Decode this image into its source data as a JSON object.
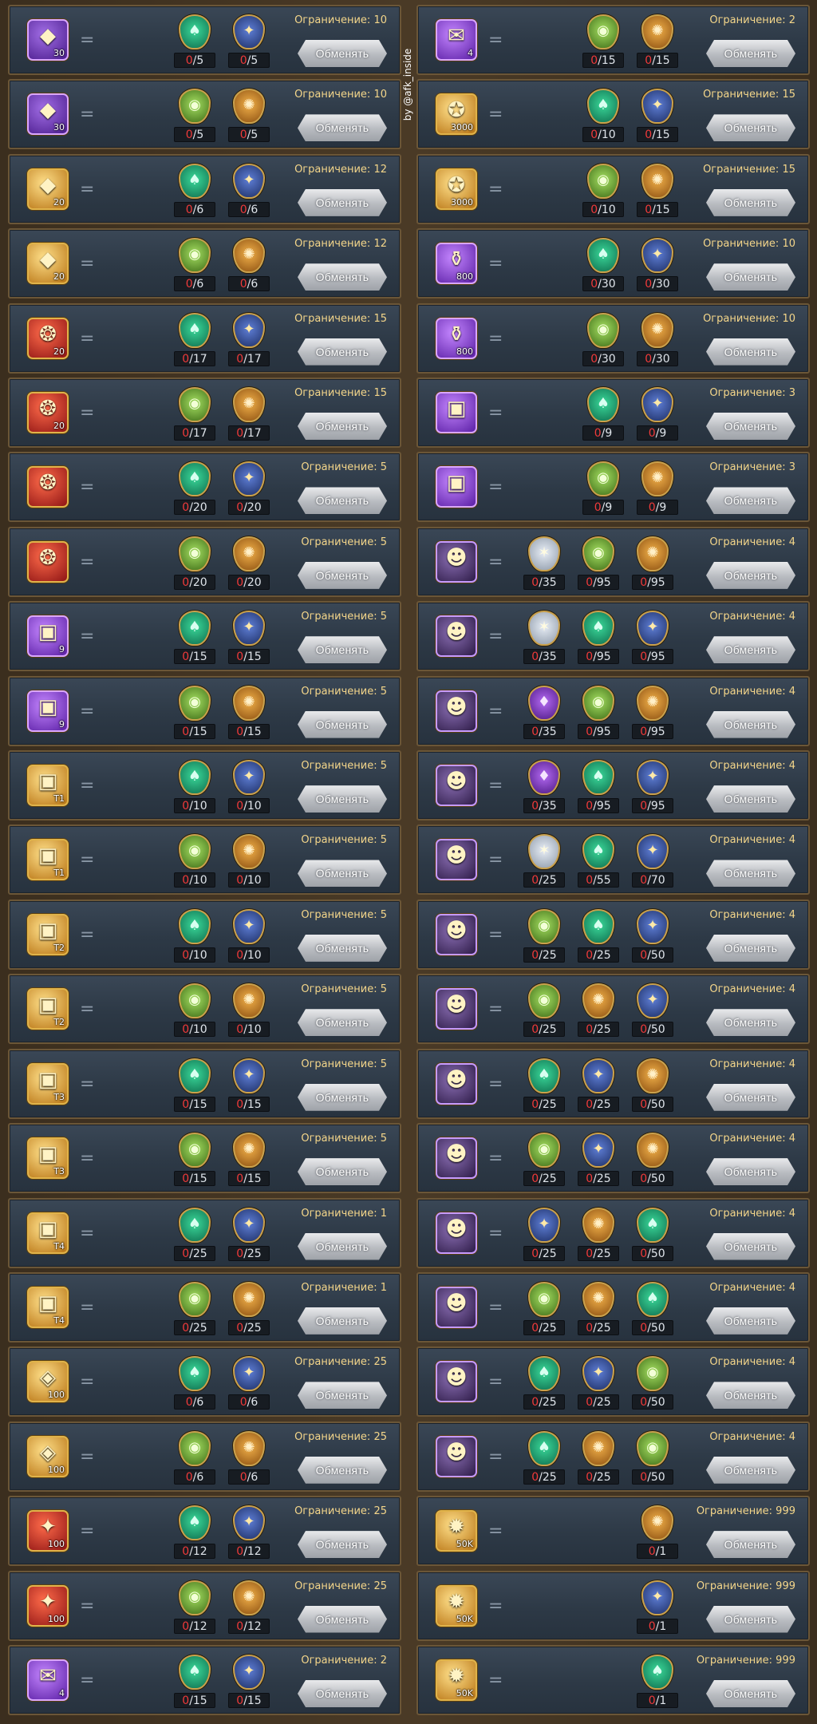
{
  "watermark": "by @afk_inside",
  "button_label": "Обменять",
  "limit_prefix": "Ограничение: ",
  "icons": {
    "green": "green-emblem-icon",
    "eye": "eye-emblem-icon",
    "star": "star-emblem-icon",
    "orb": "orb-emblem-icon",
    "silver": "silver-star-emblem-icon",
    "purple": "purple-emblem-icon",
    "coin": "gold-coin-emblem-icon"
  },
  "left_rows": [
    {
      "item": "silver-stone",
      "style": "purple",
      "glyph": "◆",
      "qty": "30",
      "limit": "10",
      "costs": [
        {
          "m": "green",
          "c": "0/5"
        },
        {
          "m": "star",
          "c": "0/5"
        }
      ]
    },
    {
      "item": "silver-stone",
      "style": "purple",
      "glyph": "◆",
      "qty": "30",
      "limit": "10",
      "costs": [
        {
          "m": "eye",
          "c": "0/5"
        },
        {
          "m": "orb",
          "c": "0/5"
        }
      ]
    },
    {
      "item": "gold-stone",
      "style": "gold",
      "glyph": "◆",
      "qty": "20",
      "limit": "12",
      "costs": [
        {
          "m": "green",
          "c": "0/6"
        },
        {
          "m": "star",
          "c": "0/6"
        }
      ]
    },
    {
      "item": "gold-stone",
      "style": "gold",
      "glyph": "◆",
      "qty": "20",
      "limit": "12",
      "costs": [
        {
          "m": "eye",
          "c": "0/6"
        },
        {
          "m": "orb",
          "c": "0/6"
        }
      ]
    },
    {
      "item": "red-chest",
      "style": "red",
      "glyph": "❂",
      "qty": "20",
      "limit": "15",
      "costs": [
        {
          "m": "green",
          "c": "0/17"
        },
        {
          "m": "star",
          "c": "0/17"
        }
      ]
    },
    {
      "item": "red-chest",
      "style": "red",
      "glyph": "❂",
      "qty": "20",
      "limit": "15",
      "costs": [
        {
          "m": "eye",
          "c": "0/17"
        },
        {
          "m": "orb",
          "c": "0/17"
        }
      ]
    },
    {
      "item": "red-shell",
      "style": "red",
      "glyph": "❂",
      "qty": "",
      "limit": "5",
      "costs": [
        {
          "m": "green",
          "c": "0/20"
        },
        {
          "m": "star",
          "c": "0/20"
        }
      ]
    },
    {
      "item": "red-shell",
      "style": "red",
      "glyph": "❂",
      "qty": "",
      "limit": "5",
      "costs": [
        {
          "m": "eye",
          "c": "0/20"
        },
        {
          "m": "orb",
          "c": "0/20"
        }
      ]
    },
    {
      "item": "purple-chest",
      "style": "violet",
      "glyph": "▣",
      "qty": "9",
      "limit": "5",
      "costs": [
        {
          "m": "green",
          "c": "0/15"
        },
        {
          "m": "star",
          "c": "0/15"
        }
      ]
    },
    {
      "item": "purple-chest",
      "style": "violet",
      "glyph": "▣",
      "qty": "9",
      "limit": "5",
      "costs": [
        {
          "m": "eye",
          "c": "0/15"
        },
        {
          "m": "orb",
          "c": "0/15"
        }
      ]
    },
    {
      "item": "t1-chest",
      "style": "gold",
      "glyph": "▣",
      "qty": "T1",
      "limit": "5",
      "costs": [
        {
          "m": "green",
          "c": "0/10"
        },
        {
          "m": "star",
          "c": "0/10"
        }
      ]
    },
    {
      "item": "t1-chest",
      "style": "gold",
      "glyph": "▣",
      "qty": "T1",
      "limit": "5",
      "costs": [
        {
          "m": "eye",
          "c": "0/10"
        },
        {
          "m": "orb",
          "c": "0/10"
        }
      ]
    },
    {
      "item": "t2-chest",
      "style": "gold",
      "glyph": "▣",
      "qty": "T2",
      "limit": "5",
      "costs": [
        {
          "m": "green",
          "c": "0/10"
        },
        {
          "m": "star",
          "c": "0/10"
        }
      ]
    },
    {
      "item": "t2-chest",
      "style": "gold",
      "glyph": "▣",
      "qty": "T2",
      "limit": "5",
      "costs": [
        {
          "m": "eye",
          "c": "0/10"
        },
        {
          "m": "orb",
          "c": "0/10"
        }
      ]
    },
    {
      "item": "t3-chest",
      "style": "gold",
      "glyph": "▣",
      "qty": "T3",
      "limit": "5",
      "costs": [
        {
          "m": "green",
          "c": "0/15"
        },
        {
          "m": "star",
          "c": "0/15"
        }
      ]
    },
    {
      "item": "t3-chest",
      "style": "gold",
      "glyph": "▣",
      "qty": "T3",
      "limit": "5",
      "costs": [
        {
          "m": "eye",
          "c": "0/15"
        },
        {
          "m": "orb",
          "c": "0/15"
        }
      ]
    },
    {
      "item": "t4-chest",
      "style": "gold",
      "glyph": "▣",
      "qty": "T4",
      "limit": "1",
      "costs": [
        {
          "m": "green",
          "c": "0/25"
        },
        {
          "m": "star",
          "c": "0/25"
        }
      ]
    },
    {
      "item": "t4-chest",
      "style": "gold",
      "glyph": "▣",
      "qty": "T4",
      "limit": "1",
      "costs": [
        {
          "m": "eye",
          "c": "0/25"
        },
        {
          "m": "orb",
          "c": "0/25"
        }
      ]
    },
    {
      "item": "blue-crystal",
      "style": "gold",
      "glyph": "◈",
      "qty": "100",
      "limit": "25",
      "costs": [
        {
          "m": "green",
          "c": "0/6"
        },
        {
          "m": "star",
          "c": "0/6"
        }
      ]
    },
    {
      "item": "blue-crystal",
      "style": "gold",
      "glyph": "◈",
      "qty": "100",
      "limit": "25",
      "costs": [
        {
          "m": "eye",
          "c": "0/6"
        },
        {
          "m": "orb",
          "c": "0/6"
        }
      ]
    },
    {
      "item": "prism-crystal",
      "style": "red",
      "glyph": "✦",
      "qty": "100",
      "limit": "25",
      "costs": [
        {
          "m": "green",
          "c": "0/12"
        },
        {
          "m": "star",
          "c": "0/12"
        }
      ]
    },
    {
      "item": "prism-crystal",
      "style": "red",
      "glyph": "✦",
      "qty": "100",
      "limit": "25",
      "costs": [
        {
          "m": "eye",
          "c": "0/12"
        },
        {
          "m": "orb",
          "c": "0/12"
        }
      ]
    },
    {
      "item": "scroll",
      "style": "violet",
      "glyph": "✉",
      "qty": "4",
      "limit": "2",
      "costs": [
        {
          "m": "green",
          "c": "0/15"
        },
        {
          "m": "star",
          "c": "0/15"
        }
      ]
    }
  ],
  "right_rows": [
    {
      "item": "scroll",
      "style": "violet",
      "glyph": "✉",
      "qty": "4",
      "limit": "2",
      "costs": [
        {
          "m": "eye",
          "c": "0/15"
        },
        {
          "m": "orb",
          "c": "0/15"
        }
      ]
    },
    {
      "item": "gold-bag",
      "style": "gold",
      "glyph": "✪",
      "qty": "3000",
      "limit": "15",
      "costs": [
        {
          "m": "green",
          "c": "0/10"
        },
        {
          "m": "star",
          "c": "0/15"
        }
      ]
    },
    {
      "item": "gold-bag",
      "style": "gold",
      "glyph": "✪",
      "qty": "3000",
      "limit": "15",
      "costs": [
        {
          "m": "eye",
          "c": "0/10"
        },
        {
          "m": "orb",
          "c": "0/15"
        }
      ]
    },
    {
      "item": "exp-potion",
      "style": "violet",
      "glyph": "⚱",
      "qty": "800",
      "limit": "10",
      "costs": [
        {
          "m": "green",
          "c": "0/30"
        },
        {
          "m": "star",
          "c": "0/30"
        }
      ]
    },
    {
      "item": "exp-potion",
      "style": "violet",
      "glyph": "⚱",
      "qty": "800",
      "limit": "10",
      "costs": [
        {
          "m": "eye",
          "c": "0/30"
        },
        {
          "m": "orb",
          "c": "0/30"
        }
      ]
    },
    {
      "item": "legend-chest",
      "style": "violet",
      "glyph": "▣",
      "qty": "",
      "limit": "3",
      "costs": [
        {
          "m": "green",
          "c": "0/9"
        },
        {
          "m": "star",
          "c": "0/9"
        }
      ]
    },
    {
      "item": "legend-chest",
      "style": "violet",
      "glyph": "▣",
      "qty": "",
      "limit": "3",
      "costs": [
        {
          "m": "eye",
          "c": "0/9"
        },
        {
          "m": "orb",
          "c": "0/9"
        }
      ]
    },
    {
      "item": "hero-1",
      "style": "hero",
      "glyph": "☻",
      "qty": "",
      "limit": "4",
      "costs": [
        {
          "m": "silver",
          "c": "0/35"
        },
        {
          "m": "eye",
          "c": "0/95"
        },
        {
          "m": "orb",
          "c": "0/95"
        }
      ]
    },
    {
      "item": "hero-2",
      "style": "hero",
      "glyph": "☻",
      "qty": "",
      "limit": "4",
      "costs": [
        {
          "m": "silver",
          "c": "0/35"
        },
        {
          "m": "green",
          "c": "0/95"
        },
        {
          "m": "star",
          "c": "0/95"
        }
      ]
    },
    {
      "item": "hero-3",
      "style": "hero",
      "glyph": "☻",
      "qty": "",
      "limit": "4",
      "costs": [
        {
          "m": "purple",
          "c": "0/35"
        },
        {
          "m": "eye",
          "c": "0/95"
        },
        {
          "m": "orb",
          "c": "0/95"
        }
      ]
    },
    {
      "item": "hero-4",
      "style": "hero",
      "glyph": "☻",
      "qty": "",
      "limit": "4",
      "costs": [
        {
          "m": "purple",
          "c": "0/35"
        },
        {
          "m": "green",
          "c": "0/95"
        },
        {
          "m": "star",
          "c": "0/95"
        }
      ]
    },
    {
      "item": "hero-5",
      "style": "hero",
      "glyph": "☻",
      "qty": "",
      "limit": "4",
      "costs": [
        {
          "m": "silver",
          "c": "0/25"
        },
        {
          "m": "green",
          "c": "0/55"
        },
        {
          "m": "star",
          "c": "0/70"
        }
      ]
    },
    {
      "item": "hero-6",
      "style": "hero",
      "glyph": "☻",
      "qty": "",
      "limit": "4",
      "costs": [
        {
          "m": "eye",
          "c": "0/25"
        },
        {
          "m": "green",
          "c": "0/25"
        },
        {
          "m": "star",
          "c": "0/50"
        }
      ]
    },
    {
      "item": "hero-7",
      "style": "hero",
      "glyph": "☻",
      "qty": "",
      "limit": "4",
      "costs": [
        {
          "m": "eye",
          "c": "0/25"
        },
        {
          "m": "orb",
          "c": "0/25"
        },
        {
          "m": "star",
          "c": "0/50"
        }
      ]
    },
    {
      "item": "hero-8",
      "style": "hero",
      "glyph": "☻",
      "qty": "",
      "limit": "4",
      "costs": [
        {
          "m": "green",
          "c": "0/25"
        },
        {
          "m": "star",
          "c": "0/25"
        },
        {
          "m": "orb",
          "c": "0/50"
        }
      ]
    },
    {
      "item": "hero-9",
      "style": "hero",
      "glyph": "☻",
      "qty": "",
      "limit": "4",
      "costs": [
        {
          "m": "eye",
          "c": "0/25"
        },
        {
          "m": "star",
          "c": "0/25"
        },
        {
          "m": "orb",
          "c": "0/50"
        }
      ]
    },
    {
      "item": "hero-10",
      "style": "hero",
      "glyph": "☻",
      "qty": "",
      "limit": "4",
      "costs": [
        {
          "m": "star",
          "c": "0/25"
        },
        {
          "m": "orb",
          "c": "0/25"
        },
        {
          "m": "green",
          "c": "0/50"
        }
      ]
    },
    {
      "item": "hero-11",
      "style": "hero",
      "glyph": "☻",
      "qty": "",
      "limit": "4",
      "costs": [
        {
          "m": "eye",
          "c": "0/25"
        },
        {
          "m": "orb",
          "c": "0/25"
        },
        {
          "m": "green",
          "c": "0/50"
        }
      ]
    },
    {
      "item": "hero-12",
      "style": "hero",
      "glyph": "☻",
      "qty": "",
      "limit": "4",
      "costs": [
        {
          "m": "green",
          "c": "0/25"
        },
        {
          "m": "star",
          "c": "0/25"
        },
        {
          "m": "eye",
          "c": "0/50"
        }
      ]
    },
    {
      "item": "hero-13",
      "style": "hero",
      "glyph": "☻",
      "qty": "",
      "limit": "4",
      "costs": [
        {
          "m": "green",
          "c": "0/25"
        },
        {
          "m": "orb",
          "c": "0/25"
        },
        {
          "m": "eye",
          "c": "0/50"
        }
      ]
    },
    {
      "item": "gold-coins",
      "style": "gold",
      "glyph": "✹",
      "qty": "50K",
      "limit": "999",
      "costs": [
        {
          "m": "orb",
          "c": "0/1"
        }
      ]
    },
    {
      "item": "gold-coins",
      "style": "gold",
      "glyph": "✹",
      "qty": "50K",
      "limit": "999",
      "costs": [
        {
          "m": "star",
          "c": "0/1"
        }
      ]
    },
    {
      "item": "gold-coins",
      "style": "gold",
      "glyph": "✹",
      "qty": "50K",
      "limit": "999",
      "costs": [
        {
          "m": "green",
          "c": "0/1"
        }
      ]
    }
  ]
}
